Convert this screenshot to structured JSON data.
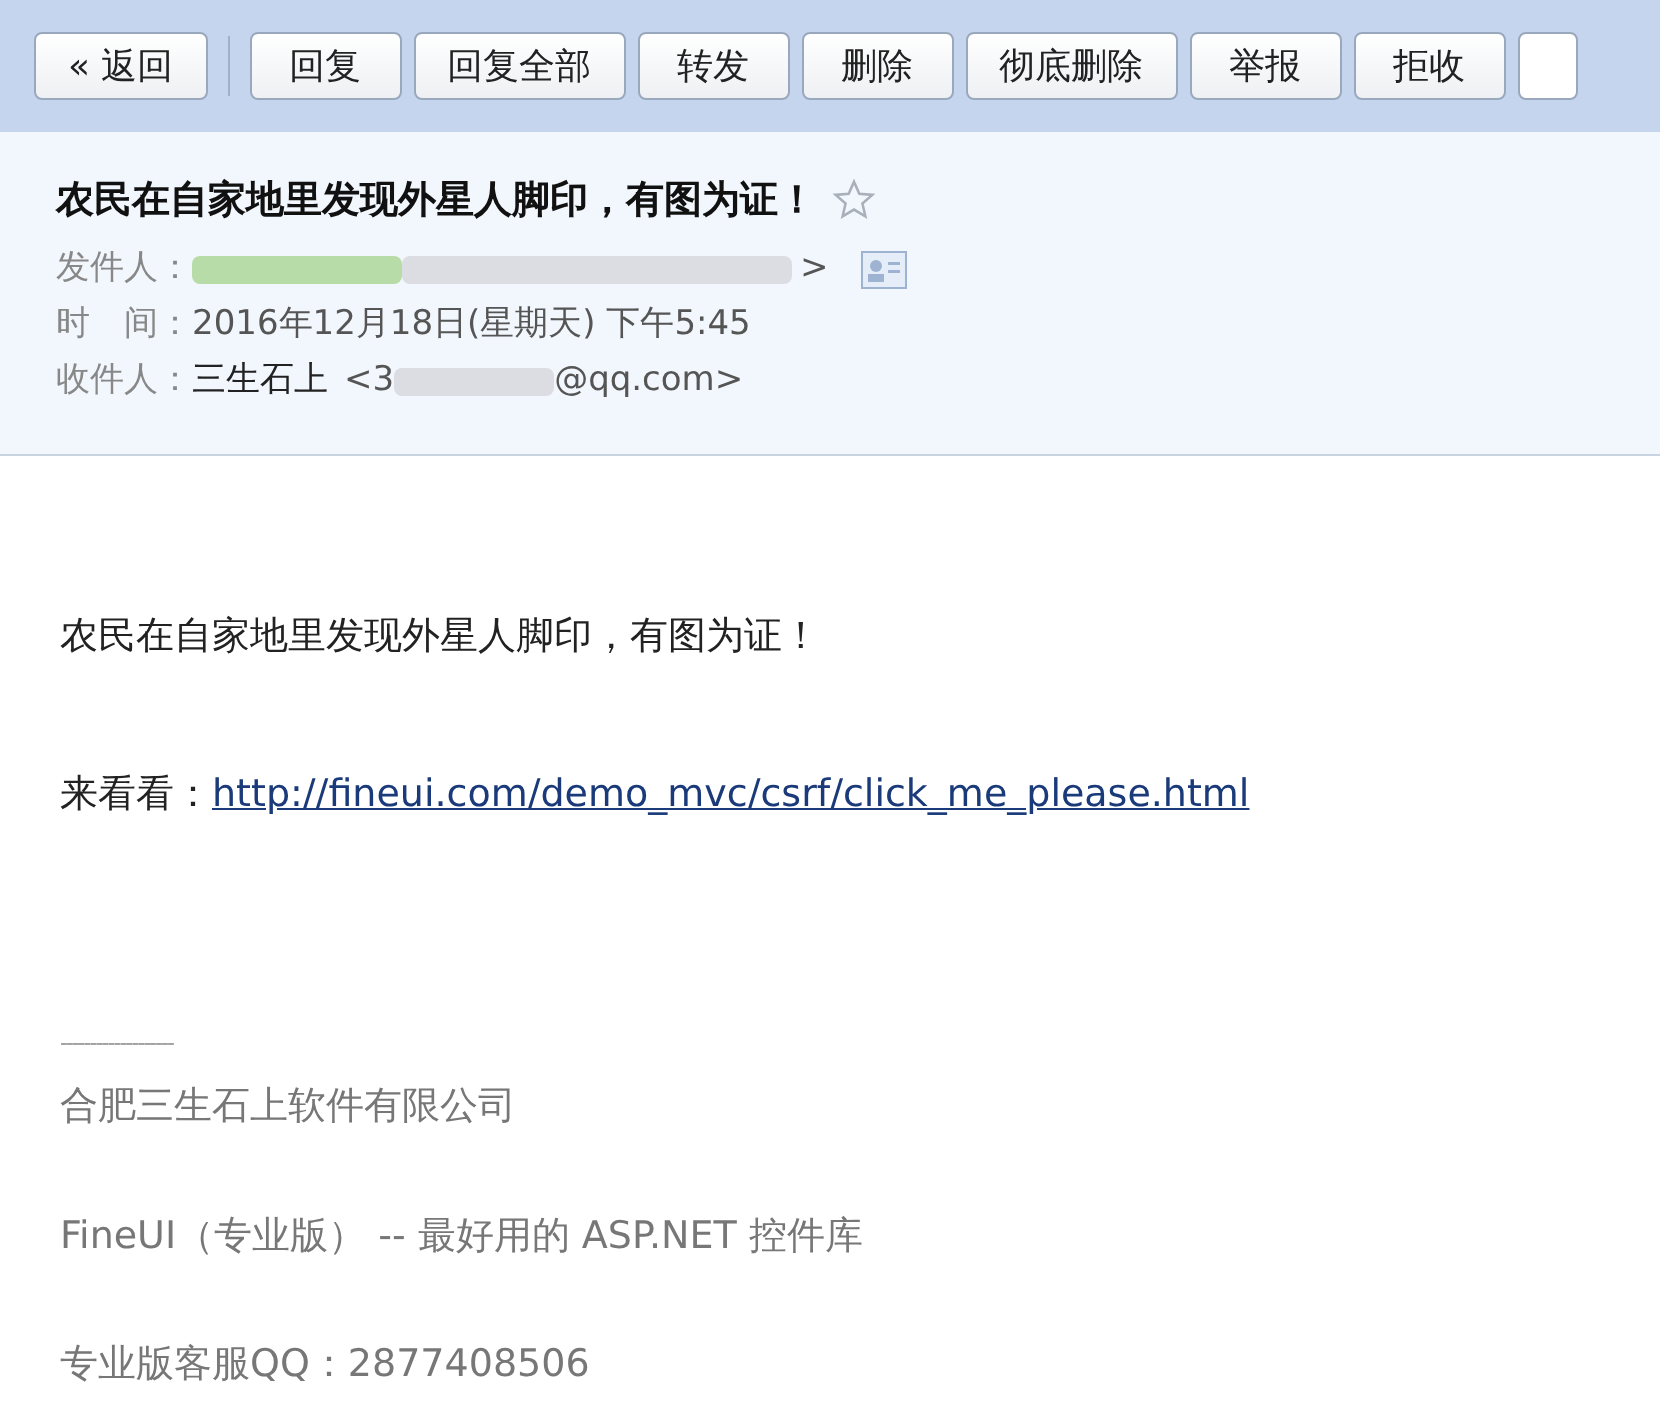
{
  "toolbar": {
    "back_button": "« 返回",
    "buttons": [
      "回复",
      "回复全部",
      "转发",
      "删除",
      "彻底删除",
      "举报",
      "拒收"
    ]
  },
  "header": {
    "subject": "农民在自家地里发现外星人脚印，有图为证！",
    "starred": false,
    "sender": {
      "label": "发件人：",
      "value": ">"
    },
    "time": {
      "label": "时　间：",
      "value": "2016年12月18日(星期天) 下午5:45"
    },
    "recipient": {
      "label": "收件人：",
      "name": "三生石上",
      "address_start": "<3",
      "address_end": "@qq.com>"
    }
  },
  "body": {
    "line": "农民在自家地里发现外星人脚印，有图为证！",
    "link_label": "来看看：",
    "link": "http://fineui.com/demo_mvc/csrf/click_me_please.html"
  },
  "signature": {
    "separator": "-------------------",
    "lines": [
      "合肥三生石上软件有限公司",
      "FineUI（专业版） --  最好用的 ASP.NET 控件库",
      "专业版客服QQ：2877408506"
    ]
  }
}
